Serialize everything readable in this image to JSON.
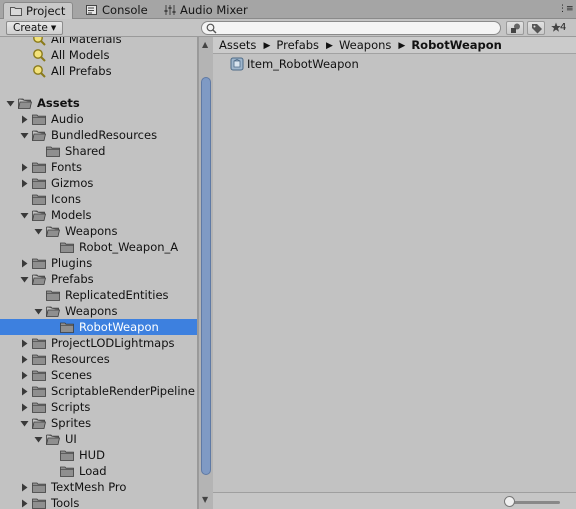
{
  "tabs": [
    {
      "label": "Project",
      "icon": "folder-icon",
      "active": true
    },
    {
      "label": "Console",
      "icon": "console-icon",
      "active": false
    },
    {
      "label": "Audio Mixer",
      "icon": "audio-mixer-icon",
      "active": false
    }
  ],
  "toolbar": {
    "create_label": "Create",
    "search_placeholder": "",
    "count_label": "4"
  },
  "tree": [
    {
      "label": "All Materials",
      "type": "search",
      "partially_visible": true
    },
    {
      "label": "All Models",
      "type": "search"
    },
    {
      "label": "All Prefabs",
      "type": "search"
    },
    {
      "label": "",
      "type": "spacer"
    },
    {
      "label": "Assets",
      "type": "folder",
      "expanded": true,
      "bold": true
    },
    {
      "label": "Audio",
      "type": "folder",
      "expanded": false
    },
    {
      "label": "BundledResources",
      "type": "folder",
      "expanded": true
    },
    {
      "label": "Shared",
      "type": "folder",
      "leaf": true
    },
    {
      "label": "Fonts",
      "type": "folder",
      "expanded": false
    },
    {
      "label": "Gizmos",
      "type": "folder",
      "expanded": false
    },
    {
      "label": "Icons",
      "type": "folder",
      "leaf": true
    },
    {
      "label": "Models",
      "type": "folder",
      "expanded": true
    },
    {
      "label": "Weapons",
      "type": "folder",
      "expanded": true
    },
    {
      "label": "Robot_Weapon_A",
      "type": "folder",
      "leaf": true
    },
    {
      "label": "Plugins",
      "type": "folder",
      "expanded": false
    },
    {
      "label": "Prefabs",
      "type": "folder",
      "expanded": true
    },
    {
      "label": "ReplicatedEntities",
      "type": "folder",
      "leaf": true
    },
    {
      "label": "Weapons",
      "type": "folder",
      "expanded": true
    },
    {
      "label": "RobotWeapon",
      "type": "folder",
      "leaf": true,
      "selected": true
    },
    {
      "label": "ProjectLODLightmaps",
      "type": "folder",
      "expanded": false
    },
    {
      "label": "Resources",
      "type": "folder",
      "expanded": false
    },
    {
      "label": "Scenes",
      "type": "folder",
      "expanded": false
    },
    {
      "label": "ScriptableRenderPipeline",
      "type": "folder",
      "expanded": false
    },
    {
      "label": "Scripts",
      "type": "folder",
      "expanded": false
    },
    {
      "label": "Sprites",
      "type": "folder",
      "expanded": true
    },
    {
      "label": "UI",
      "type": "folder",
      "expanded": true
    },
    {
      "label": "HUD",
      "type": "folder",
      "leaf": true
    },
    {
      "label": "Load",
      "type": "folder",
      "leaf": true
    },
    {
      "label": "TextMesh Pro",
      "type": "folder",
      "expanded": false
    },
    {
      "label": "Tools",
      "type": "folder",
      "expanded": false
    }
  ],
  "breadcrumb": [
    "Assets",
    "Prefabs",
    "Weapons",
    "RobotWeapon"
  ],
  "assets": [
    {
      "label": "Item_RobotWeapon",
      "icon": "prefab-icon"
    }
  ],
  "colors": {
    "selection": "#3d80df",
    "panel": "#c2c2c2",
    "scroll_thumb": "#7f9ac4"
  }
}
